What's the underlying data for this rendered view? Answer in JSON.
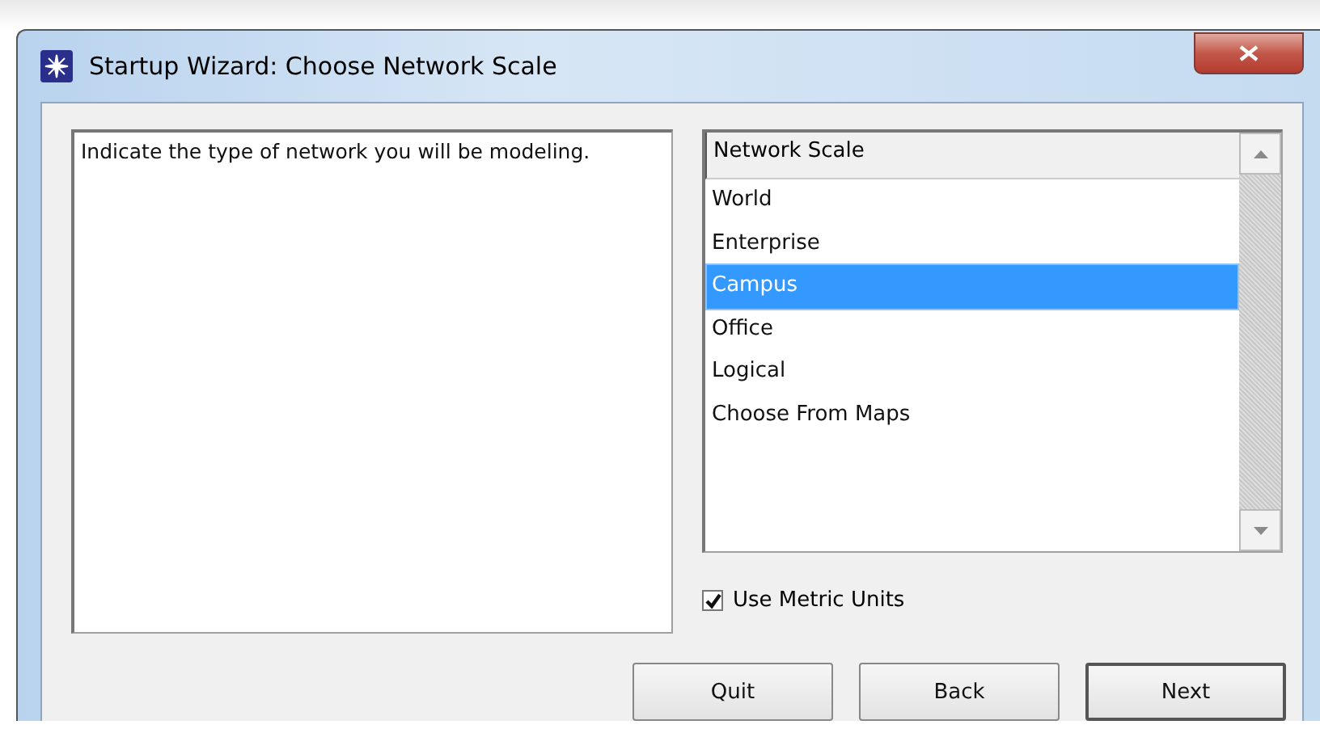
{
  "window": {
    "title": "Startup Wizard: Choose Network Scale"
  },
  "description": "Indicate the type of network you will be modeling.",
  "list": {
    "header": "Network Scale",
    "items": [
      {
        "label": "World",
        "selected": false
      },
      {
        "label": "Enterprise",
        "selected": false
      },
      {
        "label": "Campus",
        "selected": true
      },
      {
        "label": "Office",
        "selected": false
      },
      {
        "label": "Logical",
        "selected": false
      },
      {
        "label": "Choose From Maps",
        "selected": false
      }
    ]
  },
  "checkbox": {
    "label": "Use Metric Units",
    "checked": true
  },
  "buttons": [
    {
      "label": "Quit",
      "default": false
    },
    {
      "label": "Back",
      "default": false
    },
    {
      "label": "Next",
      "default": true
    }
  ]
}
